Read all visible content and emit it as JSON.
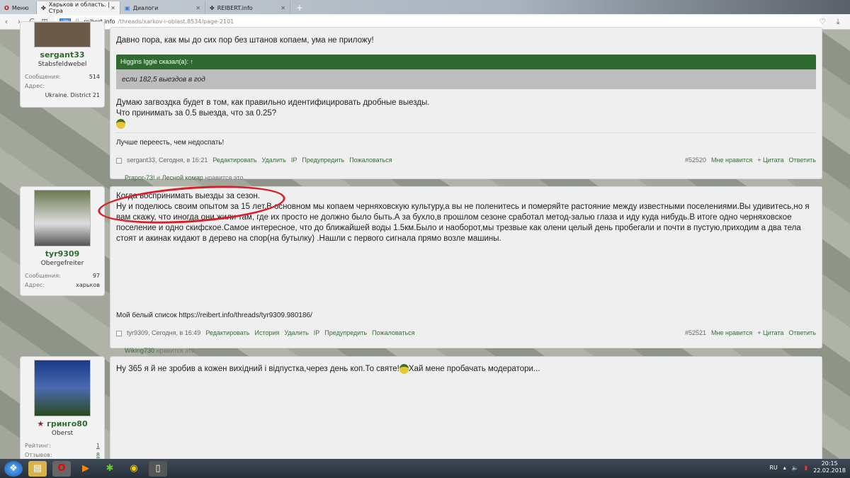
{
  "browser": {
    "menu": "Меню",
    "tabs": [
      {
        "label": "Харьков и область. | Стра",
        "active": true
      },
      {
        "label": "Диалоги"
      },
      {
        "label": "REIBERT.info"
      }
    ],
    "url_host": "reibert.info",
    "url_path": "/threads/xarkov-i-oblast.8534/page-2101",
    "vpn": "VPN"
  },
  "posts": [
    {
      "user": "sergant33",
      "rank": "Stabsfeldwebel",
      "stats": [
        {
          "k": "Сообщения:",
          "v": "514"
        },
        {
          "k": "Адрес:",
          "v": ""
        }
      ],
      "address_line": "Ukraine. District 21",
      "lines": [
        "Давно пора, как мы до сих пор без штанов копаем, ума не приложу!"
      ],
      "quote_author": "Higgins Iggie сказал(а): ↑",
      "quote_text": "если 182,5 выездов в год",
      "after": [
        "Думаю загвоздка будет в том, как правильно идентифицировать дробные выезды.",
        "Что принимать за 0.5 выезда, что за 0.25?"
      ],
      "signature": "Лучше переесть, чем недоспать!",
      "meta": "sergant33, Сегодня, в 16:21",
      "actions": [
        "Редактировать",
        "Удалить",
        "IP",
        "Предупредить",
        "Пожаловаться"
      ],
      "number": "#52520",
      "right": [
        "Мне нравится",
        "+ Цитата",
        "Ответить"
      ],
      "likes_users": [
        "Prapor-73!",
        "Лесной комар"
      ],
      "likes_and": " и ",
      "likes_suffix": " нравится это."
    },
    {
      "user": "tyr9309",
      "rank": "Obergefreiter",
      "stats": [
        {
          "k": "Сообщения:",
          "v": "97"
        },
        {
          "k": "Адрес:",
          "v": "харьков"
        }
      ],
      "text": "Когда воспринимать выезды за сезон.\nНу и поделюсь своим опытом за 15 лет.В основном мы копаем черняховскую культуру,а вы не поленитесь и померяйте растояние между известными поселениями.Вы удивитесь,но я вам скажу, что иногда они жили там, где их просто не должно было быть.А за бухло,в прошлом сезоне сработал метод-залью глаза и иду куда нибудь.В итоге одно черняховское поселение и одно скифское.Самое интересное, что до ближайшей воды 1.5км.Было и наоборот,мы трезвые как олени целый день пробегали и почти в пустую,приходим а два тела стоят и акинак кидают в дерево на спор(на бутылку) .Нашли с первого сигнала прямо возле машины.",
      "signature": "Мой белый список https://reibert.info/threads/tyr9309.980186/",
      "meta": "tyr9309, Сегодня, в 16:49",
      "actions": [
        "Редактировать",
        "История",
        "Удалить",
        "IP",
        "Предупредить",
        "Пожаловаться"
      ],
      "number": "#52521",
      "right": [
        "Мне нравится",
        "+ Цитата",
        "Ответить"
      ],
      "likes_users": [
        "Wiking730"
      ],
      "likes_suffix": " нравится это."
    },
    {
      "user": "гринго80",
      "rank": "Oberst",
      "stats": [
        {
          "k": "Рейтинг:",
          "v": "1"
        },
        {
          "k": "Отзывов:",
          "v": "8"
        }
      ],
      "text_a": "Ну 365 я й не зробив а кожен вихідний і відпустка,через день коп.То святе!",
      "text_b": "Хай мене пробачать модератори..."
    }
  ],
  "taskbar": {
    "lang": "RU",
    "time": "20:15",
    "date": "22.02.2018"
  }
}
